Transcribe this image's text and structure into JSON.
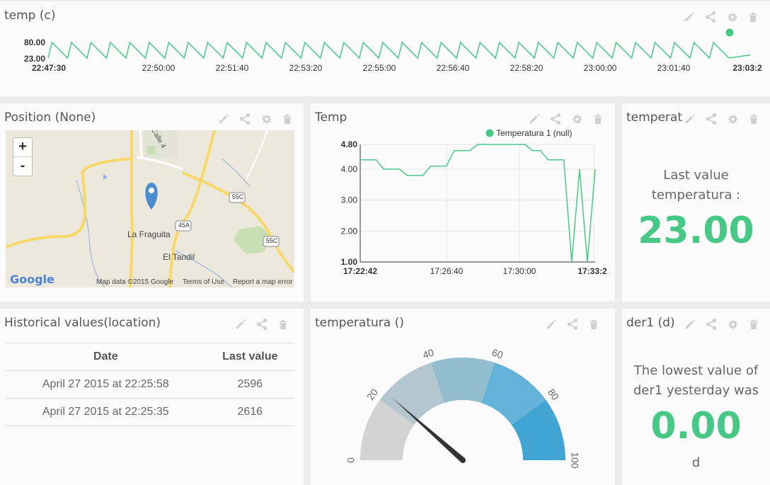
{
  "colors": {
    "accent": "#47c886",
    "gauge": [
      "#d3d3d3",
      "#b4c7d1",
      "#93bccf",
      "#63b3d9",
      "#41a4d2"
    ]
  },
  "tool_icons": [
    "pencil-icon",
    "share-icon",
    "gear-icon",
    "trash-icon"
  ],
  "w_temp": {
    "title": "temp (c)",
    "chart_data": {
      "type": "line",
      "y_ticks": [
        "80.00",
        "23.00"
      ],
      "ylim": [
        23,
        80
      ],
      "x_ticks": [
        "22:47:30",
        "22:50:00",
        "22:51:40",
        "22:53:20",
        "22:55:00",
        "22:56:40",
        "22:58:20",
        "23:00:00",
        "23:01:40",
        "23:03:2"
      ],
      "x_range": [
        "22:47:30",
        "23:03:20"
      ],
      "series": [
        {
          "pattern": "sawtooth",
          "cycles": 35,
          "low": 23,
          "high": 80,
          "last_point": 80
        }
      ]
    }
  },
  "w_map": {
    "title": "Position (None)",
    "zoom_in": "+",
    "zoom_out": "-",
    "labels": {
      "town1": "La Fraguita",
      "town2": "El Tandil",
      "road1": "55C",
      "road2": "45A",
      "road3": "55C",
      "street": "Calle 4"
    },
    "footer": {
      "logo": "Google",
      "mapdata": "Map data ©2015 Google",
      "terms": "Terms of Use",
      "report": "Report a map error"
    }
  },
  "w_temp2": {
    "title": "Temp",
    "chart_data": {
      "type": "line",
      "legend": "Temperatura 1 (null)",
      "y_ticks": [
        "4.80",
        "4.00",
        "3.00",
        "2.00",
        "1.00"
      ],
      "ylim": [
        1.0,
        4.8
      ],
      "x_ticks": [
        "17:22:42",
        "17:26:40",
        "17:30:00",
        "17:33:2"
      ],
      "series": [
        {
          "name": "Temperatura 1",
          "values": [
            4.3,
            4.3,
            4.3,
            4.0,
            4.0,
            4.0,
            3.8,
            3.8,
            3.8,
            4.1,
            4.1,
            4.1,
            4.6,
            4.6,
            4.6,
            4.8,
            4.8,
            4.8,
            4.8,
            4.8,
            4.8,
            4.8,
            4.6,
            4.6,
            4.3,
            4.3,
            4.3,
            1.0,
            4.0,
            1.0,
            4.0
          ]
        }
      ]
    }
  },
  "w_last": {
    "title": "temperat",
    "desc_line1": "Last value",
    "desc_line2": "temperatura :",
    "value": "23.00"
  },
  "w_hist": {
    "title": "Historical values(location)",
    "columns": [
      "Date",
      "Last value"
    ],
    "rows": [
      [
        "April 27 2015 at 22:25:58",
        "2596"
      ],
      [
        "April 27 2015 at 22:25:35",
        "2616"
      ]
    ]
  },
  "w_gauge": {
    "title": "temperatura ()",
    "chart_data": {
      "type": "gauge",
      "min": 0,
      "max": 100,
      "ticks": [
        "0",
        "20",
        "40",
        "60",
        "80",
        "100"
      ],
      "value": 23
    }
  },
  "w_der": {
    "title": "der1 (d)",
    "desc_line1": "The lowest value of",
    "desc_line2": "der1 yesterday was",
    "value": "0.00",
    "unit": "d"
  }
}
